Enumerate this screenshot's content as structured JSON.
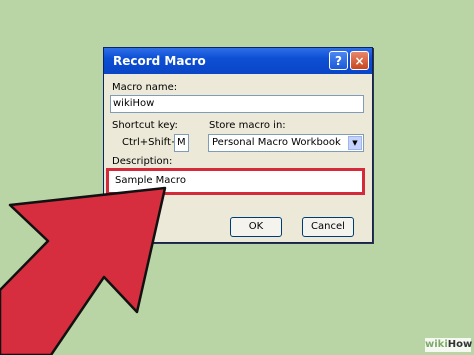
{
  "dialog": {
    "title": "Record Macro",
    "help_button": "?",
    "close_button": "×",
    "macro_name_label": "Macro name:",
    "macro_name_value": "wikiHow",
    "shortcut_label": "Shortcut key:",
    "shortcut_prefix": "Ctrl+Shift+",
    "shortcut_value": "M",
    "store_label": "Store macro in:",
    "store_value": "Personal Macro Workbook",
    "description_label": "Description:",
    "description_value": "Sample Macro",
    "ok_label": "OK",
    "cancel_label": "Cancel"
  },
  "watermark": {
    "wiki": "wiki",
    "how": "How"
  },
  "colors": {
    "title_bar": "#0a45c6",
    "highlight": "#d42a3a",
    "background": "#b9d5a5"
  },
  "icons": {
    "help": "question-mark-icon",
    "close": "close-icon",
    "dropdown": "chevron-down-icon",
    "pointer": "red-arrow-icon"
  }
}
